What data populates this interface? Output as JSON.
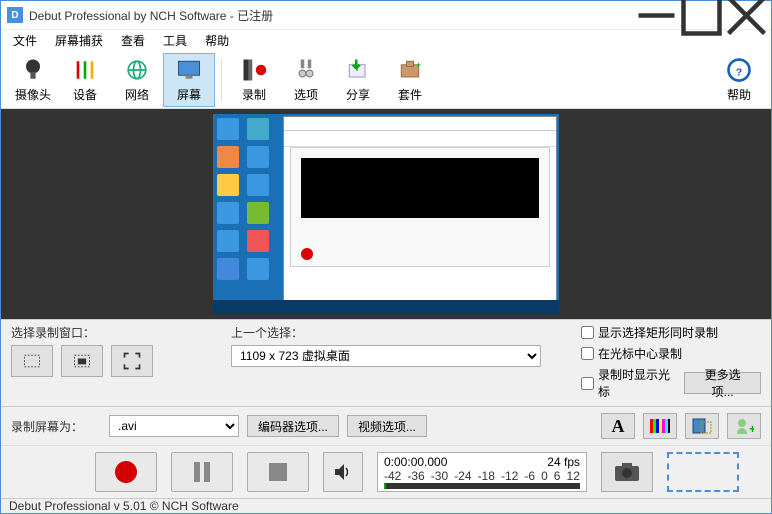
{
  "window": {
    "title": "Debut Professional by NCH Software - 已注册"
  },
  "menu": {
    "file": "文件",
    "capture": "屏幕捕获",
    "view": "查看",
    "tools": "工具",
    "help": "帮助"
  },
  "toolbar": {
    "camera": "摄像头",
    "device": "设备",
    "network": "网络",
    "screen": "屏幕",
    "record": "录制",
    "options": "选项",
    "share": "分享",
    "suite": "套件",
    "help": "帮助"
  },
  "selection": {
    "window_label": "选择录制窗口：",
    "prev_label": "上一个选择：",
    "prev_value": "1109 x 723 虚拟桌面",
    "chk1": "显示选择矩形同时录制",
    "chk2": "在光标中心录制",
    "chk3": "录制时显示光标",
    "more": "更多选项..."
  },
  "format": {
    "label": "录制屏幕为：",
    "ext": ".avi",
    "encoder": "编码器选项...",
    "video": "视频选项..."
  },
  "timeline": {
    "time": "0:00:00.000",
    "fps": "24 fps",
    "ticks": [
      "-42",
      "-36",
      "-30",
      "-24",
      "-18",
      "-12",
      "-6",
      "0",
      "6",
      "12"
    ]
  },
  "status": "Debut Professional v 5.01 © NCH Software"
}
